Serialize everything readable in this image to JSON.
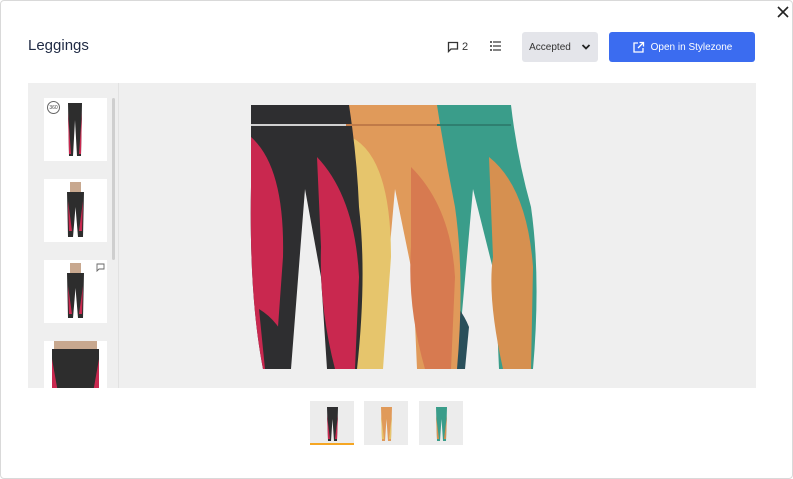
{
  "header": {
    "title": "Leggings",
    "comment_count": "2",
    "status_label": "Accepted",
    "open_label": "Open in Stylezone"
  },
  "side_thumbnails": [
    {
      "badge": "360"
    },
    {},
    {},
    {}
  ],
  "colorways": [
    "black-pink",
    "orange-yellow",
    "teal-orange"
  ],
  "colors": {
    "accent_button": "#3b6cf0",
    "selected_underline": "#f5a623",
    "status_bg": "#e4e5ea"
  }
}
